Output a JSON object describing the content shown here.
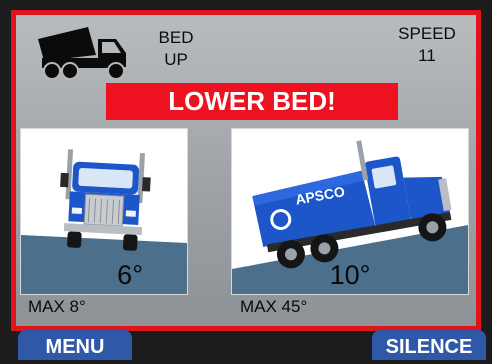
{
  "status": {
    "icon": "dump-truck-icon",
    "bed_line1": "BED",
    "bed_line2": "UP",
    "speed_label": "SPEED",
    "speed_value": "11"
  },
  "alarm": {
    "text": "LOWER BED!",
    "color": "#ee1120"
  },
  "roll": {
    "view": "front",
    "angle": "6°",
    "max": "MAX 8°"
  },
  "pitch": {
    "view": "side",
    "angle": "10°",
    "max": "MAX 45°",
    "truck_brand": "APSCO"
  },
  "softkeys": {
    "menu": "MENU",
    "silence": "SILENCE"
  },
  "colors": {
    "frame": "#e1141b",
    "softkey": "#2f58a8",
    "truck": "#1d56c9",
    "ground": "#4c6f8c"
  }
}
